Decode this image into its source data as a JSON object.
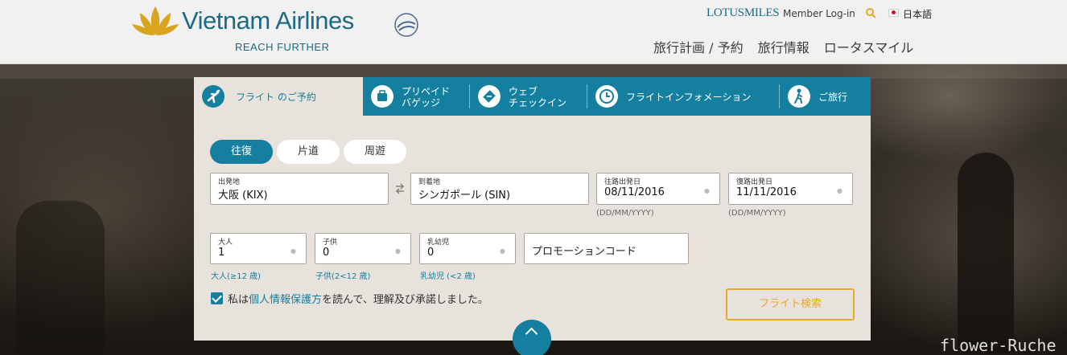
{
  "header": {
    "brand": "Vietnam Airlines",
    "tagline": "REACH FURTHER",
    "lotusmiles": "LOTUSMILES",
    "member_login": "Member Log-in",
    "language": "日本語",
    "nav": [
      "旅行計画 / 予約",
      "旅行情報",
      "ロータスマイル"
    ]
  },
  "tabs": [
    {
      "label_1": "フライト のご予約",
      "label_2": "",
      "icon": "airplane-icon",
      "active": true
    },
    {
      "label_1": "プリペイド",
      "label_2": "バゲッジ",
      "icon": "luggage-icon",
      "active": false
    },
    {
      "label_1": "ウェブ",
      "label_2": "チェックイン",
      "icon": "ticket-icon",
      "active": false
    },
    {
      "label_1": "フライトインフォメーション",
      "label_2": "",
      "icon": "clock-icon",
      "active": false
    },
    {
      "label_1": "ご旅行",
      "label_2": "",
      "icon": "traveler-icon",
      "active": false
    }
  ],
  "trip_types": [
    "往復",
    "片道",
    "周遊"
  ],
  "selected_trip_type": "往復",
  "fields": {
    "origin": {
      "label": "出発地",
      "value": "大阪 (KIX)"
    },
    "destination": {
      "label": "到着地",
      "value": "シンガポール (SIN)"
    },
    "depart_date": {
      "label": "往路出発日",
      "value": "08/11/2016",
      "hint": "(DD/MM/YYYY)"
    },
    "return_date": {
      "label": "復路出発日",
      "value": "11/11/2016",
      "hint": "(DD/MM/YYYY)"
    },
    "adults": {
      "label": "大人",
      "value": "1",
      "hint": "大人(≥12 歳)"
    },
    "children": {
      "label": "子供",
      "value": "0",
      "hint": "子供(2<12 歳)"
    },
    "infants": {
      "label": "乳幼児",
      "value": "0",
      "hint": "乳幼児 (<2 歳)"
    },
    "promo": {
      "placeholder": "プロモーションコード"
    }
  },
  "agreement": {
    "prefix": "私は",
    "link": "個人情報保護方",
    "suffix": "を読んで、理解及び承諾しました。",
    "checked": true
  },
  "search_button": "フライト検索",
  "watermark": "flower-Ruche",
  "colors": {
    "accent": "#157fa0",
    "button": "#e6a92a",
    "panel": "#e7e3dc"
  }
}
